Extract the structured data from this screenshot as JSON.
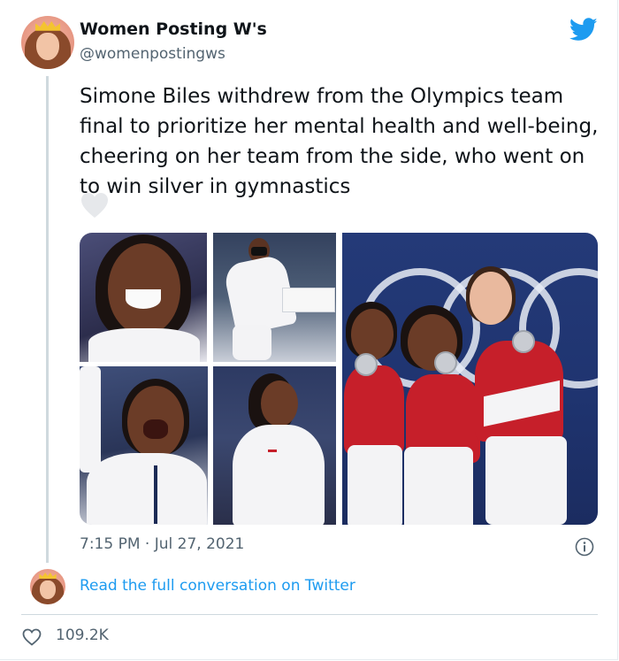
{
  "author": {
    "name": "Women Posting W's",
    "handle": "@womenpostingws",
    "avatar_icon": "crowned-woman-avatar"
  },
  "brand": {
    "icon": "twitter-bird-icon",
    "color": "#1d9bf0"
  },
  "tweet": {
    "text": "Simone Biles withdrew from the Olympics team final to prioritize her mental health and well-being, cheering on her team from the side, who went on to win silver in gymnastics",
    "emoji_icon": "white-heart-icon",
    "timestamp": "7:15 PM · Jul 27, 2021"
  },
  "media": {
    "photo_count": 5
  },
  "footer": {
    "read_link": "Read the full conversation on Twitter",
    "like_count": "109.2K"
  },
  "colors": {
    "text": "#0f1419",
    "secondary": "#536471",
    "link": "#1d9bf0",
    "divider": "#cfd9de"
  }
}
